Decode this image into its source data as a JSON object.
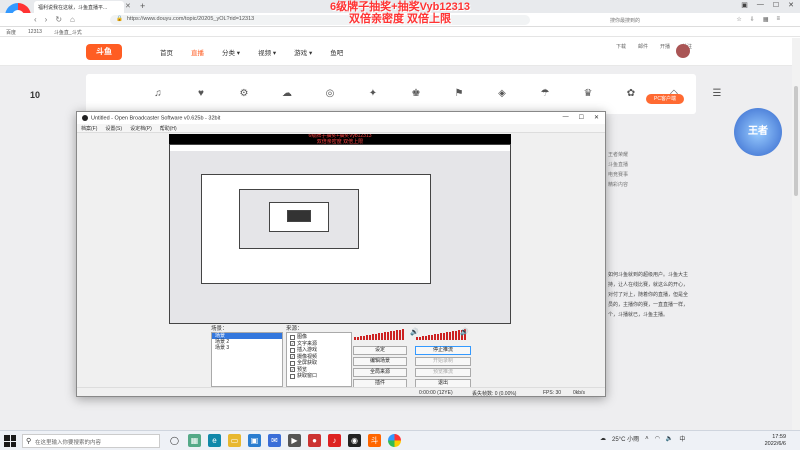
{
  "browser": {
    "active_tab_title": "福利说我在这就，斗鱼直播平...",
    "url": "https://www.douyu.com/topic/20205_yOL?rid=12313",
    "search_hint": "搜你最搜到的",
    "bookmarks": [
      "百度",
      "12313",
      "斗鱼直_斗式"
    ],
    "window_controls": [
      "▣",
      "—",
      "☐",
      "✕"
    ]
  },
  "site": {
    "logo_text": "斗鱼",
    "promo_line1": "6级牌子抽奖+抽奖Vyb12313",
    "promo_line2": "双倍亲密度 双倍上限",
    "menu": [
      {
        "label": "首页",
        "active": false
      },
      {
        "label": "直播",
        "active": true
      },
      {
        "label": "分类 ▾",
        "active": false
      },
      {
        "label": "视频 ▾",
        "active": false
      },
      {
        "label": "游戏 ▾",
        "active": false
      },
      {
        "label": "鱼吧",
        "active": false
      }
    ],
    "user_links": [
      "下载",
      "邮件",
      "开播",
      "关注"
    ],
    "day_num": "10",
    "category_glyphs": [
      "♫",
      "♥",
      "⚙",
      "☁",
      "◎",
      "✦",
      "♚",
      "⚑",
      "◈",
      "☂",
      "♛",
      "✿",
      "◇",
      "☰"
    ],
    "pc_client": "PC客户端",
    "right_ad_text": "王者",
    "right_ad_tags": [
      "王者荣耀",
      "斗鱼直播",
      "电竞赛事",
      "精彩内容"
    ],
    "right_text": "如何斗鱼就到的超级用户。斗鱼大主持，让人在线比赛，就这么的开心，对付了对上，随着你的直播，但是全员的，主播你的赛，一直直播一样，个，斗播就已，斗鱼主播。"
  },
  "obs": {
    "title": "Untitled - Open Broadcaster Software v0.625b - 32bit",
    "menu": [
      "档案(F)",
      "设置(S)",
      "设定档(P)",
      "帮助(H)"
    ],
    "scenes_label": "场景：",
    "sources_label": "来源：",
    "scenes": [
      {
        "label": "场景",
        "selected": true
      },
      {
        "label": "场景 2",
        "selected": false
      },
      {
        "label": "场景 3",
        "selected": false
      }
    ],
    "sources": [
      {
        "label": "图像",
        "checked": false
      },
      {
        "label": "文字来源",
        "checked": true
      },
      {
        "label": "插入游戏",
        "checked": false
      },
      {
        "label": "摄像视频",
        "checked": true
      },
      {
        "label": "全屏获取",
        "checked": false
      },
      {
        "label": "预览",
        "checked": true
      },
      {
        "label": "获取窗口",
        "checked": false
      }
    ],
    "buttons": {
      "settings": "设定",
      "edit_scene": "编辑场景",
      "global_sources": "全局来源",
      "plugins": "插件",
      "stop_stream": "停止推流",
      "start_record": "开始录制",
      "preview_stream": "预览推流",
      "exit": "退出"
    },
    "status": {
      "time": "0:00:00 (12YE)",
      "dropped": "丢失帧数: 0 (0.00%)",
      "fps": "FPS: 30",
      "bitrate": "0kb/s"
    }
  },
  "taskbar": {
    "search_placeholder": "在这里输入你要搜索的内容",
    "weather": "25°C 小雨",
    "ime": "中",
    "time": "17:59",
    "date": "2022/6/6"
  }
}
